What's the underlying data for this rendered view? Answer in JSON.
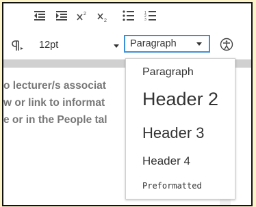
{
  "toolbar": {
    "font_size_value": "12pt",
    "block_format_value": "Paragraph"
  },
  "editor": {
    "lines": [
      "o lecturer/s associat",
      "w or link to informat",
      "e or in the People tal"
    ]
  },
  "format_menu": {
    "items": [
      "Paragraph",
      "Header 2",
      "Header 3",
      "Header 4",
      "Preformatted"
    ]
  },
  "icons": [
    "outdent-icon",
    "indent-icon",
    "superscript-icon",
    "subscript-icon",
    "bullet-list-icon",
    "numbered-list-icon",
    "paragraph-mark-icon",
    "accessibility-icon"
  ],
  "colors": {
    "page_bg": "#fcf3c9",
    "focus_border": "#3a8fd6"
  }
}
